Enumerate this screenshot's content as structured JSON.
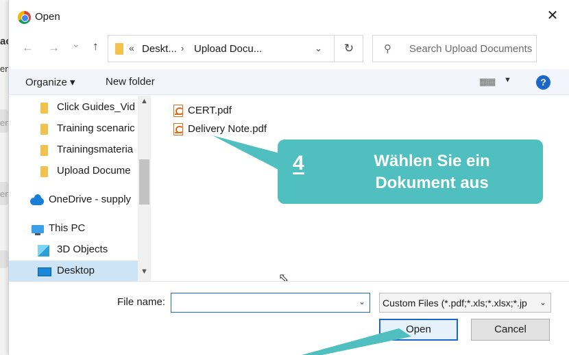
{
  "background": {
    "fragments": [
      "ac",
      "en",
      "en",
      "en"
    ]
  },
  "dialog": {
    "title": "Open",
    "close_glyph": "✕",
    "icon": "chrome-icon"
  },
  "address_bar": {
    "back_glyph": "←",
    "forward_glyph": "→",
    "recent_glyph": "⌄",
    "up_glyph": "↑",
    "overflow_glyph": "«",
    "crumbs": [
      "Deskt...",
      "Upload Docu..."
    ],
    "crumb_separator": "›",
    "dropdown_glyph": "⌄",
    "refresh_glyph": "↻"
  },
  "search": {
    "placeholder": "Search Upload Documents",
    "icon_glyph": "⚲"
  },
  "toolbar": {
    "organize_label": "Organize ▾",
    "new_folder_label": "New folder",
    "view_glyph": "▦▦",
    "view_dropdown_glyph": "▼",
    "help_glyph": "?"
  },
  "tree": {
    "items": [
      {
        "label": "Click Guides_Vid"
      },
      {
        "label": "Training scenaric"
      },
      {
        "label": "Trainingsmateria"
      },
      {
        "label": "Upload Docume"
      },
      {
        "label": "OneDrive - supply"
      },
      {
        "label": "This PC"
      },
      {
        "label": "3D Objects"
      },
      {
        "label": "Desktop"
      }
    ],
    "scroll_up_glyph": "▲",
    "scroll_down_glyph": "▼"
  },
  "files": [
    {
      "name": "CERT.pdf"
    },
    {
      "name": "Delivery Note.pdf"
    }
  ],
  "callout": {
    "step": "4",
    "text_line1": "Wählen Sie ein",
    "text_line2": "Dokument aus",
    "color": "#4fbfbf"
  },
  "bottom": {
    "file_name_label": "File name:",
    "file_name_value": "",
    "file_name_dropdown_glyph": "⌄",
    "filter_value": "Custom Files (*.pdf;*.xls;*.xlsx;*.jp",
    "filter_dropdown_glyph": "⌄",
    "open_label": "Open",
    "cancel_label": "Cancel"
  },
  "colors": {
    "accent": "#1a66c9",
    "selection": "#cde4f7",
    "folder": "#f2c14e",
    "pdf": "#e06a1b"
  }
}
